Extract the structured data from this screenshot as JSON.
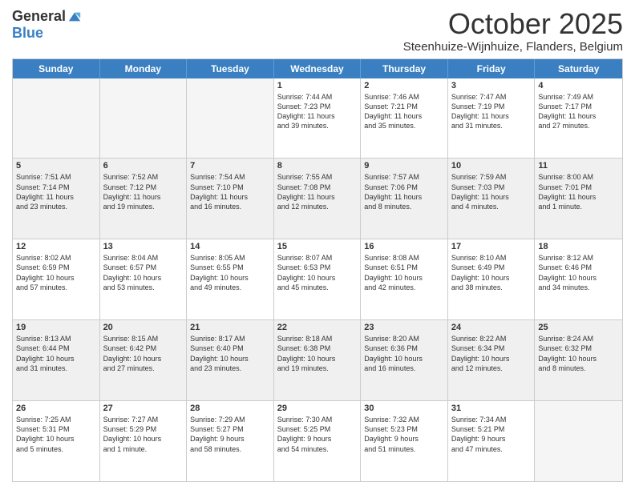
{
  "logo": {
    "general": "General",
    "blue": "Blue"
  },
  "title": "October 2025",
  "location": "Steenhuize-Wijnhuize, Flanders, Belgium",
  "weekdays": [
    "Sunday",
    "Monday",
    "Tuesday",
    "Wednesday",
    "Thursday",
    "Friday",
    "Saturday"
  ],
  "weeks": [
    [
      {
        "day": "",
        "content": ""
      },
      {
        "day": "",
        "content": ""
      },
      {
        "day": "",
        "content": ""
      },
      {
        "day": "1",
        "content": "Sunrise: 7:44 AM\nSunset: 7:23 PM\nDaylight: 11 hours\nand 39 minutes."
      },
      {
        "day": "2",
        "content": "Sunrise: 7:46 AM\nSunset: 7:21 PM\nDaylight: 11 hours\nand 35 minutes."
      },
      {
        "day": "3",
        "content": "Sunrise: 7:47 AM\nSunset: 7:19 PM\nDaylight: 11 hours\nand 31 minutes."
      },
      {
        "day": "4",
        "content": "Sunrise: 7:49 AM\nSunset: 7:17 PM\nDaylight: 11 hours\nand 27 minutes."
      }
    ],
    [
      {
        "day": "5",
        "content": "Sunrise: 7:51 AM\nSunset: 7:14 PM\nDaylight: 11 hours\nand 23 minutes."
      },
      {
        "day": "6",
        "content": "Sunrise: 7:52 AM\nSunset: 7:12 PM\nDaylight: 11 hours\nand 19 minutes."
      },
      {
        "day": "7",
        "content": "Sunrise: 7:54 AM\nSunset: 7:10 PM\nDaylight: 11 hours\nand 16 minutes."
      },
      {
        "day": "8",
        "content": "Sunrise: 7:55 AM\nSunset: 7:08 PM\nDaylight: 11 hours\nand 12 minutes."
      },
      {
        "day": "9",
        "content": "Sunrise: 7:57 AM\nSunset: 7:06 PM\nDaylight: 11 hours\nand 8 minutes."
      },
      {
        "day": "10",
        "content": "Sunrise: 7:59 AM\nSunset: 7:03 PM\nDaylight: 11 hours\nand 4 minutes."
      },
      {
        "day": "11",
        "content": "Sunrise: 8:00 AM\nSunset: 7:01 PM\nDaylight: 11 hours\nand 1 minute."
      }
    ],
    [
      {
        "day": "12",
        "content": "Sunrise: 8:02 AM\nSunset: 6:59 PM\nDaylight: 10 hours\nand 57 minutes."
      },
      {
        "day": "13",
        "content": "Sunrise: 8:04 AM\nSunset: 6:57 PM\nDaylight: 10 hours\nand 53 minutes."
      },
      {
        "day": "14",
        "content": "Sunrise: 8:05 AM\nSunset: 6:55 PM\nDaylight: 10 hours\nand 49 minutes."
      },
      {
        "day": "15",
        "content": "Sunrise: 8:07 AM\nSunset: 6:53 PM\nDaylight: 10 hours\nand 45 minutes."
      },
      {
        "day": "16",
        "content": "Sunrise: 8:08 AM\nSunset: 6:51 PM\nDaylight: 10 hours\nand 42 minutes."
      },
      {
        "day": "17",
        "content": "Sunrise: 8:10 AM\nSunset: 6:49 PM\nDaylight: 10 hours\nand 38 minutes."
      },
      {
        "day": "18",
        "content": "Sunrise: 8:12 AM\nSunset: 6:46 PM\nDaylight: 10 hours\nand 34 minutes."
      }
    ],
    [
      {
        "day": "19",
        "content": "Sunrise: 8:13 AM\nSunset: 6:44 PM\nDaylight: 10 hours\nand 31 minutes."
      },
      {
        "day": "20",
        "content": "Sunrise: 8:15 AM\nSunset: 6:42 PM\nDaylight: 10 hours\nand 27 minutes."
      },
      {
        "day": "21",
        "content": "Sunrise: 8:17 AM\nSunset: 6:40 PM\nDaylight: 10 hours\nand 23 minutes."
      },
      {
        "day": "22",
        "content": "Sunrise: 8:18 AM\nSunset: 6:38 PM\nDaylight: 10 hours\nand 19 minutes."
      },
      {
        "day": "23",
        "content": "Sunrise: 8:20 AM\nSunset: 6:36 PM\nDaylight: 10 hours\nand 16 minutes."
      },
      {
        "day": "24",
        "content": "Sunrise: 8:22 AM\nSunset: 6:34 PM\nDaylight: 10 hours\nand 12 minutes."
      },
      {
        "day": "25",
        "content": "Sunrise: 8:24 AM\nSunset: 6:32 PM\nDaylight: 10 hours\nand 8 minutes."
      }
    ],
    [
      {
        "day": "26",
        "content": "Sunrise: 7:25 AM\nSunset: 5:31 PM\nDaylight: 10 hours\nand 5 minutes."
      },
      {
        "day": "27",
        "content": "Sunrise: 7:27 AM\nSunset: 5:29 PM\nDaylight: 10 hours\nand 1 minute."
      },
      {
        "day": "28",
        "content": "Sunrise: 7:29 AM\nSunset: 5:27 PM\nDaylight: 9 hours\nand 58 minutes."
      },
      {
        "day": "29",
        "content": "Sunrise: 7:30 AM\nSunset: 5:25 PM\nDaylight: 9 hours\nand 54 minutes."
      },
      {
        "day": "30",
        "content": "Sunrise: 7:32 AM\nSunset: 5:23 PM\nDaylight: 9 hours\nand 51 minutes."
      },
      {
        "day": "31",
        "content": "Sunrise: 7:34 AM\nSunset: 5:21 PM\nDaylight: 9 hours\nand 47 minutes."
      },
      {
        "day": "",
        "content": ""
      }
    ]
  ]
}
